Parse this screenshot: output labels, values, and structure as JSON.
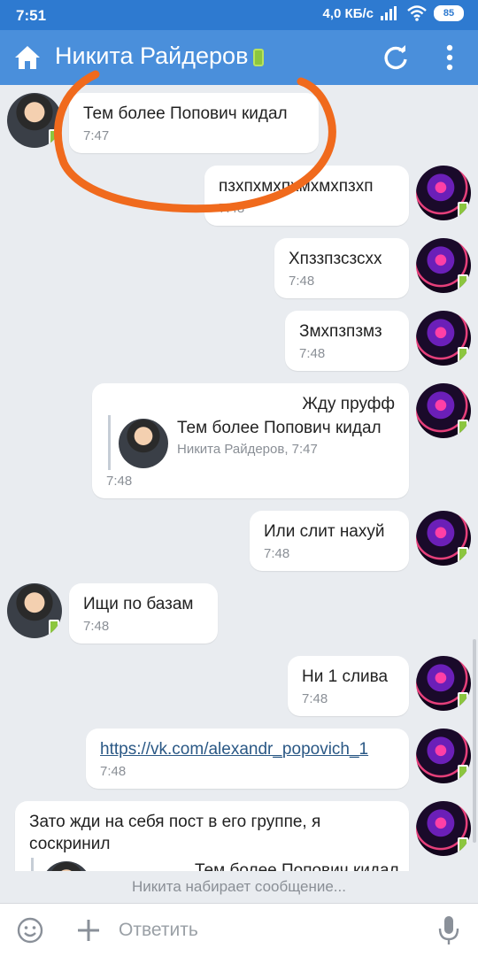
{
  "status_bar": {
    "time": "7:51",
    "speed": "4,0 КБ/с",
    "battery": "85"
  },
  "header": {
    "title": "Никита Райдеров"
  },
  "messages": [
    {
      "sender": "Никита Райдеров",
      "text": "Тем более Попович кидал",
      "time": "7:47"
    },
    {
      "sender": "me",
      "text": "пзхпхмхпхмхмхпзхп",
      "time": "7:48"
    },
    {
      "sender": "me",
      "text": "Хпззпзсзсхх",
      "time": "7:48"
    },
    {
      "sender": "me",
      "text": "Змхпзпзмз",
      "time": "7:48"
    },
    {
      "sender": "me",
      "text": "Жду пруфф",
      "time": "7:48",
      "quote": {
        "text": "Тем более Попович кидал",
        "meta": "Никита Райдеров, 7:47"
      }
    },
    {
      "sender": "me",
      "text": "Или слит нахуй",
      "time": "7:48"
    },
    {
      "sender": "Никита Райдеров",
      "text": "Ищи по базам",
      "time": "7:48"
    },
    {
      "sender": "me",
      "text": "Ни 1 слива",
      "time": "7:48"
    },
    {
      "sender": "me",
      "text": "https://vk.com/alexandr_popovich_1",
      "time": "7:48"
    },
    {
      "sender": "me",
      "text_line1": "Зато жди на себя пост в его группе, я",
      "text_line2": "соскринил",
      "quote": {
        "text": "Тем более Попович кидал"
      }
    }
  ],
  "typing_indicator": "Никита набирает сообщение...",
  "composer": {
    "placeholder": "Ответить"
  },
  "colors": {
    "statusbar": "#2e7ad0",
    "topbar": "#4a8fdb",
    "background": "#e9ecf0",
    "annotation": "#f06a1d"
  }
}
